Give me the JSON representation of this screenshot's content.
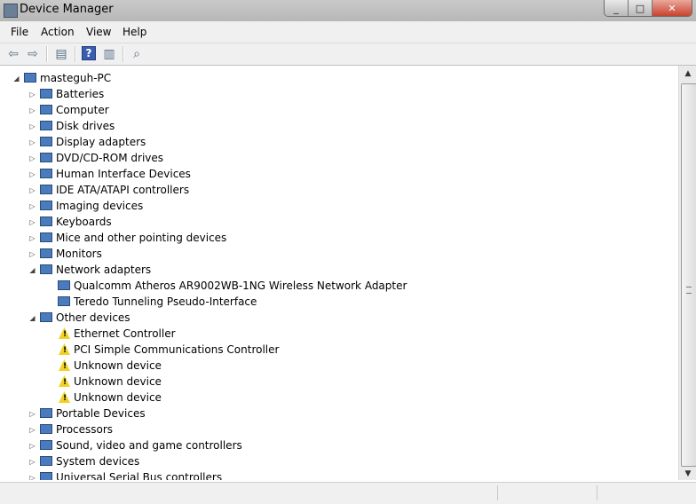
{
  "window": {
    "title": "Device Manager"
  },
  "menu": [
    "File",
    "Action",
    "View",
    "Help"
  ],
  "tree": {
    "root": "masteguh-PC",
    "categories": [
      {
        "label": "Batteries"
      },
      {
        "label": "Computer"
      },
      {
        "label": "Disk drives"
      },
      {
        "label": "Display adapters"
      },
      {
        "label": "DVD/CD-ROM drives"
      },
      {
        "label": "Human Interface Devices"
      },
      {
        "label": "IDE ATA/ATAPI controllers"
      },
      {
        "label": "Imaging devices"
      },
      {
        "label": "Keyboards"
      },
      {
        "label": "Mice and other pointing devices"
      },
      {
        "label": "Monitors"
      },
      {
        "label": "Network adapters",
        "expanded": true,
        "children": [
          {
            "label": "Qualcomm Atheros AR9002WB-1NG Wireless Network Adapter"
          },
          {
            "label": "Teredo Tunneling Pseudo-Interface"
          }
        ]
      },
      {
        "label": "Other devices",
        "expanded": true,
        "children": [
          {
            "label": "Ethernet Controller",
            "warning": true
          },
          {
            "label": "PCI Simple Communications Controller",
            "warning": true
          },
          {
            "label": "Unknown device",
            "warning": true
          },
          {
            "label": "Unknown device",
            "warning": true
          },
          {
            "label": "Unknown device",
            "warning": true
          }
        ]
      },
      {
        "label": "Portable Devices"
      },
      {
        "label": "Processors"
      },
      {
        "label": "Sound, video and game controllers"
      },
      {
        "label": "System devices"
      },
      {
        "label": "Universal Serial Bus controllers"
      }
    ]
  }
}
